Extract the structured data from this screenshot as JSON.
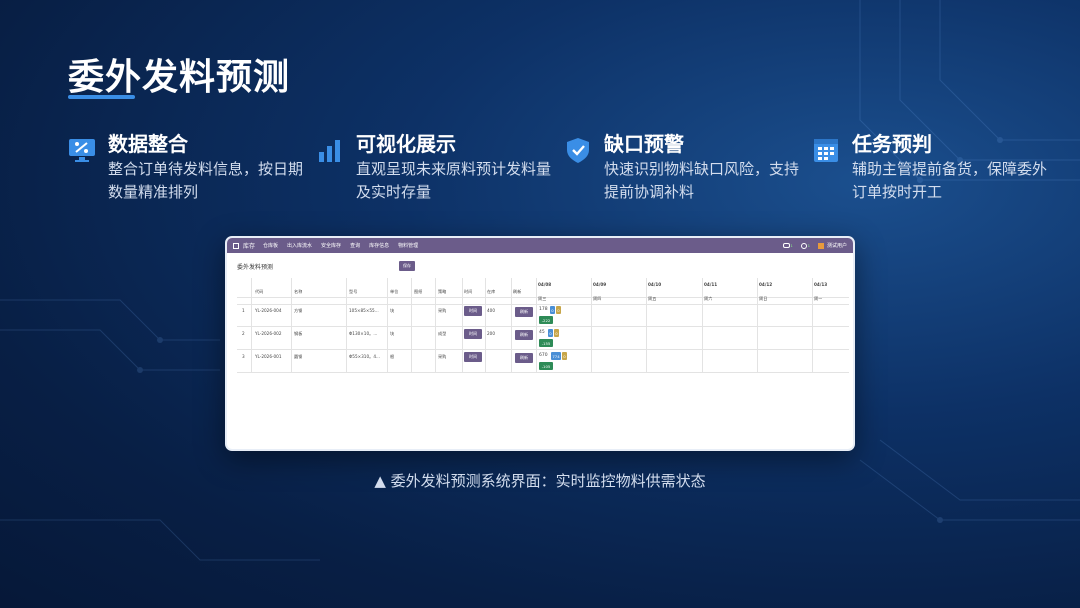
{
  "slide": {
    "title": "委外发料预测",
    "caption": "▲ 委外发料预测系统界面：实时监控物料供需状态"
  },
  "features": [
    {
      "icon": "monitor-chart-icon",
      "title": "数据整合",
      "desc": "整合订单待发料信息，按日期数量精准排列"
    },
    {
      "icon": "bar-chart-icon",
      "title": "可视化展示",
      "desc": "直观呈现未来原料预计发料量及实时存量"
    },
    {
      "icon": "shield-check-icon",
      "title": "缺口预警",
      "desc": "快速识别物料缺口风险，支持提前协调补料"
    },
    {
      "icon": "calendar-grid-icon",
      "title": "任务预判",
      "desc": "辅助主管提前备货，保障委外订单按时开工"
    }
  ],
  "app": {
    "name": "库存",
    "menu": [
      "仓库板",
      "出入库流水",
      "安全库存",
      "查询",
      "库存信息",
      "物料管理"
    ],
    "user": "测试用户",
    "badge1": "1",
    "badge2": "1",
    "page_title": "委外发料预测",
    "save_label": "保存",
    "columns": [
      "代码",
      "名称",
      "型号",
      "单位",
      "图纸",
      "策略",
      "时间",
      "在库",
      "刷新"
    ],
    "dates": [
      {
        "date": "04/08",
        "day": "周三"
      },
      {
        "date": "04/09",
        "day": "周四"
      },
      {
        "date": "04/10",
        "day": "周五"
      },
      {
        "date": "04/11",
        "day": "周六"
      },
      {
        "date": "04/12",
        "day": "周日"
      },
      {
        "date": "04/13",
        "day": "周一"
      }
    ],
    "rows": [
      {
        "idx": "1",
        "code": "YL-2026-004",
        "name": "方钢",
        "model": "105×85×55...",
        "unit": "块",
        "drawing": "",
        "strategy": "采购",
        "time_btn": "时间",
        "stock": "400",
        "refresh_btn": "刷新",
        "qty": "178",
        "b1": "0",
        "b2": "0",
        "gap": "-222",
        "b1c": "#4a8fd6",
        "b2c": "#c7a64a",
        "gapc": "#2e8b57"
      },
      {
        "idx": "2",
        "code": "YL-2026-002",
        "name": "钢板",
        "model": "Φ130×10。...",
        "unit": "块",
        "drawing": "",
        "strategy": "成型",
        "time_btn": "时间",
        "stock": "200",
        "refresh_btn": "刷新",
        "qty": "45",
        "b1": "0",
        "b2": "0",
        "gap": "-155",
        "b1c": "#4a8fd6",
        "b2c": "#c7a64a",
        "gapc": "#2e8b57"
      },
      {
        "idx": "3",
        "code": "YL-2026-001",
        "name": "圆钢",
        "model": "Φ55×310。4...",
        "unit": "根",
        "drawing": "",
        "strategy": "采购",
        "time_btn": "时间",
        "stock": "",
        "refresh_btn": "刷新",
        "qty": "670",
        "b1": "774",
        "b2": "0",
        "gap": "-105",
        "b1c": "#4a8fd6",
        "b2c": "#c7a64a",
        "gapc": "#2e8b57"
      }
    ]
  },
  "colors": {
    "accent": "#3a8ee6",
    "nav": "#6b5c8a",
    "bg": "#0d3166"
  }
}
